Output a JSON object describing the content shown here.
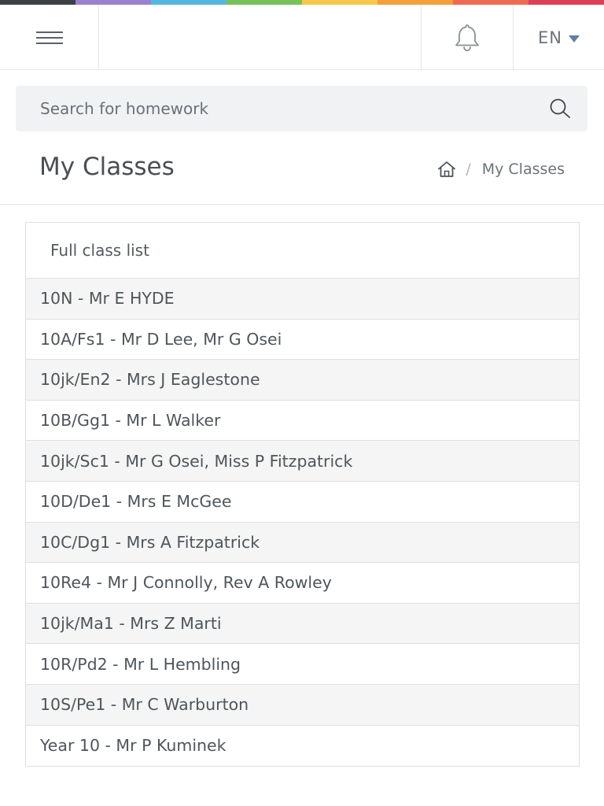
{
  "rainbow_colors": [
    "#3d4045",
    "#9b7fd0",
    "#55b7e0",
    "#76c15a",
    "#f4c84a",
    "#f3a03c",
    "#ef6a52",
    "#de3f58"
  ],
  "header": {
    "menu_icon": "hamburger-menu-icon",
    "bell_icon": "bell-icon",
    "language": "EN"
  },
  "search": {
    "placeholder": "Search for homework",
    "icon": "search-icon"
  },
  "page": {
    "title": "My Classes",
    "breadcrumb": {
      "home_icon": "home-icon",
      "separator": "/",
      "current": "My Classes"
    }
  },
  "panel": {
    "heading": "Full class list",
    "classes": [
      "10N - Mr E HYDE",
      "10A/Fs1 - Mr D Lee, Mr G Osei",
      "10jk/En2 - Mrs J Eaglestone",
      "10B/Gg1 - Mr L Walker",
      "10jk/Sc1 - Mr G Osei, Miss P Fitzpatrick",
      "10D/De1 - Mrs E McGee",
      "10C/Dg1 - Mrs A Fitzpatrick",
      "10Re4 - Mr J Connolly, Rev A Rowley",
      "10jk/Ma1 - Mrs Z Marti",
      "10R/Pd2 - Mr L Hembling",
      "10S/Pe1 - Mr C Warburton",
      "Year 10 - Mr P Kuminek"
    ]
  },
  "colors": {
    "accent_caret": "#5f7ea0",
    "border": "#dcdfe2",
    "search_bg": "#f1f2f4",
    "stripe_bg": "#f5f5f5"
  }
}
